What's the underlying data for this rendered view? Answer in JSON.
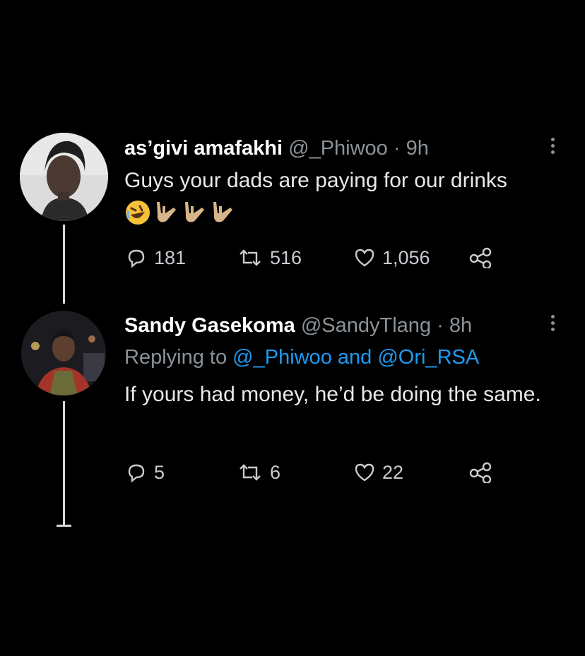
{
  "tweets": [
    {
      "name": "as’givi amafakhi",
      "handle": "@_Phiwoo",
      "separator": "·",
      "time": "9h",
      "text": "Guys your dads are paying for our drinks",
      "emojis": [
        "rolling-on-floor-laughing",
        "love-you-gesture",
        "love-you-gesture",
        "love-you-gesture"
      ],
      "replies": "181",
      "retweets": "516",
      "likes": "1,056"
    },
    {
      "name": "Sandy Gasekoma",
      "handle": "@SandyTlang",
      "separator": "·",
      "time": "8h",
      "replying_prefix": "Replying to",
      "replying_to_1": "@_Phiwoo",
      "replying_and": "and",
      "replying_to_2": "@Ori_RSA",
      "text": "If yours had money, he’d be doing the same.",
      "replies": "5",
      "retweets": "6",
      "likes": "22"
    }
  ],
  "colors": {
    "background": "#000000",
    "text": "#e7e9ea",
    "muted": "#8b9298",
    "link": "#1d9bf0"
  },
  "icons": [
    "reply-icon",
    "retweet-icon",
    "like-icon",
    "share-icon",
    "more-icon"
  ]
}
